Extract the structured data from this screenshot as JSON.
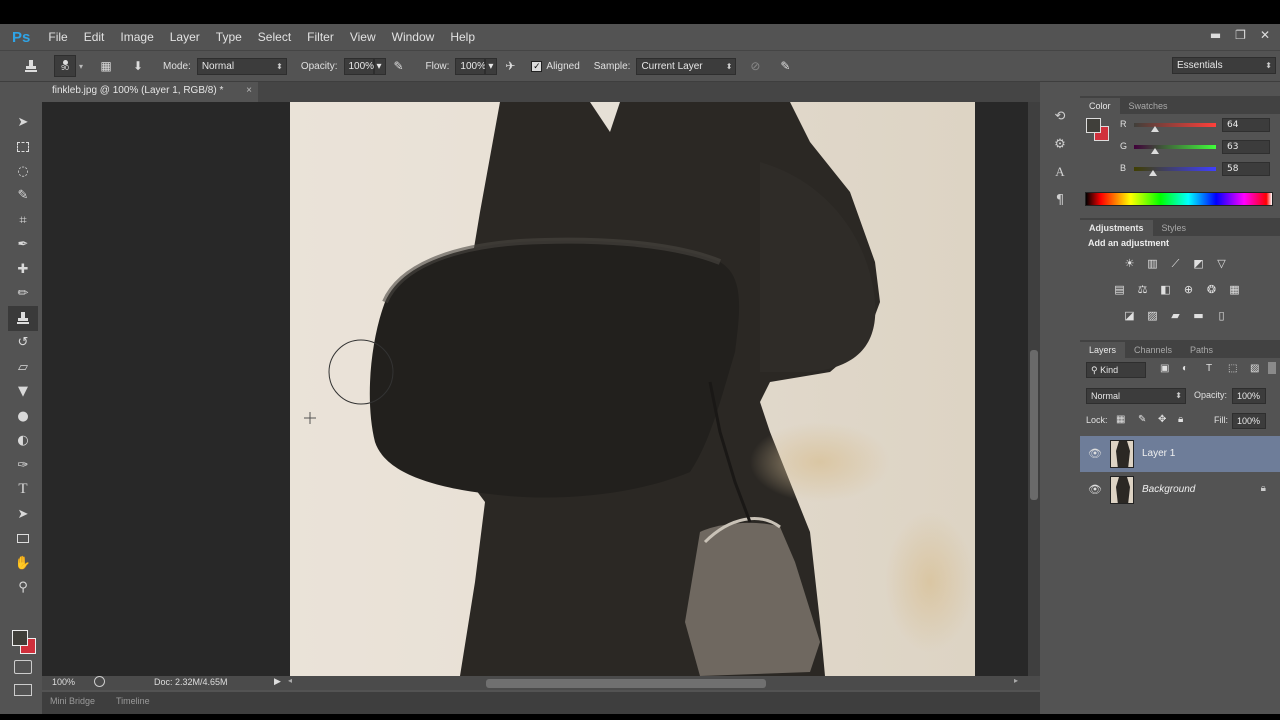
{
  "app": {
    "logo": "Ps"
  },
  "menu": [
    "File",
    "Edit",
    "Image",
    "Layer",
    "Type",
    "Select",
    "Filter",
    "View",
    "Window",
    "Help"
  ],
  "window_controls": {
    "minimize": "▬",
    "restore": "❐",
    "close": "✕"
  },
  "options_bar": {
    "brush_size": "90",
    "mode_label": "Mode:",
    "mode_value": "Normal",
    "opacity_label": "Opacity:",
    "opacity_value": "100%",
    "flow_label": "Flow:",
    "flow_value": "100%",
    "aligned_label": "Aligned",
    "aligned_checked": true,
    "sample_label": "Sample:",
    "sample_value": "Current Layer",
    "workspace": "Essentials"
  },
  "document": {
    "tab_title": "finkleb.jpg @ 100% (Layer 1, RGB/8) *",
    "zoom": "100%",
    "doc_info": "Doc: 2.32M/4.65M"
  },
  "bottom_tabs": [
    "Mini Bridge",
    "Timeline"
  ],
  "color_panel": {
    "tabs": [
      "Color",
      "Swatches"
    ],
    "active_tab": "Color",
    "r_label": "R",
    "r_value": "64",
    "g_label": "G",
    "g_value": "63",
    "b_label": "B",
    "b_value": "58",
    "foreground": "#403f3a",
    "background": "#d0303c"
  },
  "adjustments_panel": {
    "tabs": [
      "Adjustments",
      "Styles"
    ],
    "active_tab": "Adjustments",
    "heading": "Add an adjustment",
    "icons_row1": [
      "brightness-icon",
      "levels-icon",
      "curves-icon",
      "exposure-icon",
      "vibrance-icon"
    ],
    "icons_row2": [
      "hue-saturation-icon",
      "color-balance-icon",
      "black-white-icon",
      "photo-filter-icon",
      "channel-mixer-icon",
      "color-lookup-icon"
    ],
    "icons_row3": [
      "invert-icon",
      "posterize-icon",
      "threshold-icon",
      "gradient-map-icon",
      "selective-color-icon"
    ]
  },
  "layers_panel": {
    "tabs": [
      "Layers",
      "Channels",
      "Paths"
    ],
    "active_tab": "Layers",
    "filter_kind": "Kind",
    "blend_mode": "Normal",
    "opacity_label": "Opacity:",
    "opacity_value": "100%",
    "lock_label": "Lock:",
    "fill_label": "Fill:",
    "fill_value": "100%",
    "layers": [
      {
        "name": "Layer 1",
        "selected": true,
        "locked": false
      },
      {
        "name": "Background",
        "selected": false,
        "locked": true
      }
    ]
  }
}
